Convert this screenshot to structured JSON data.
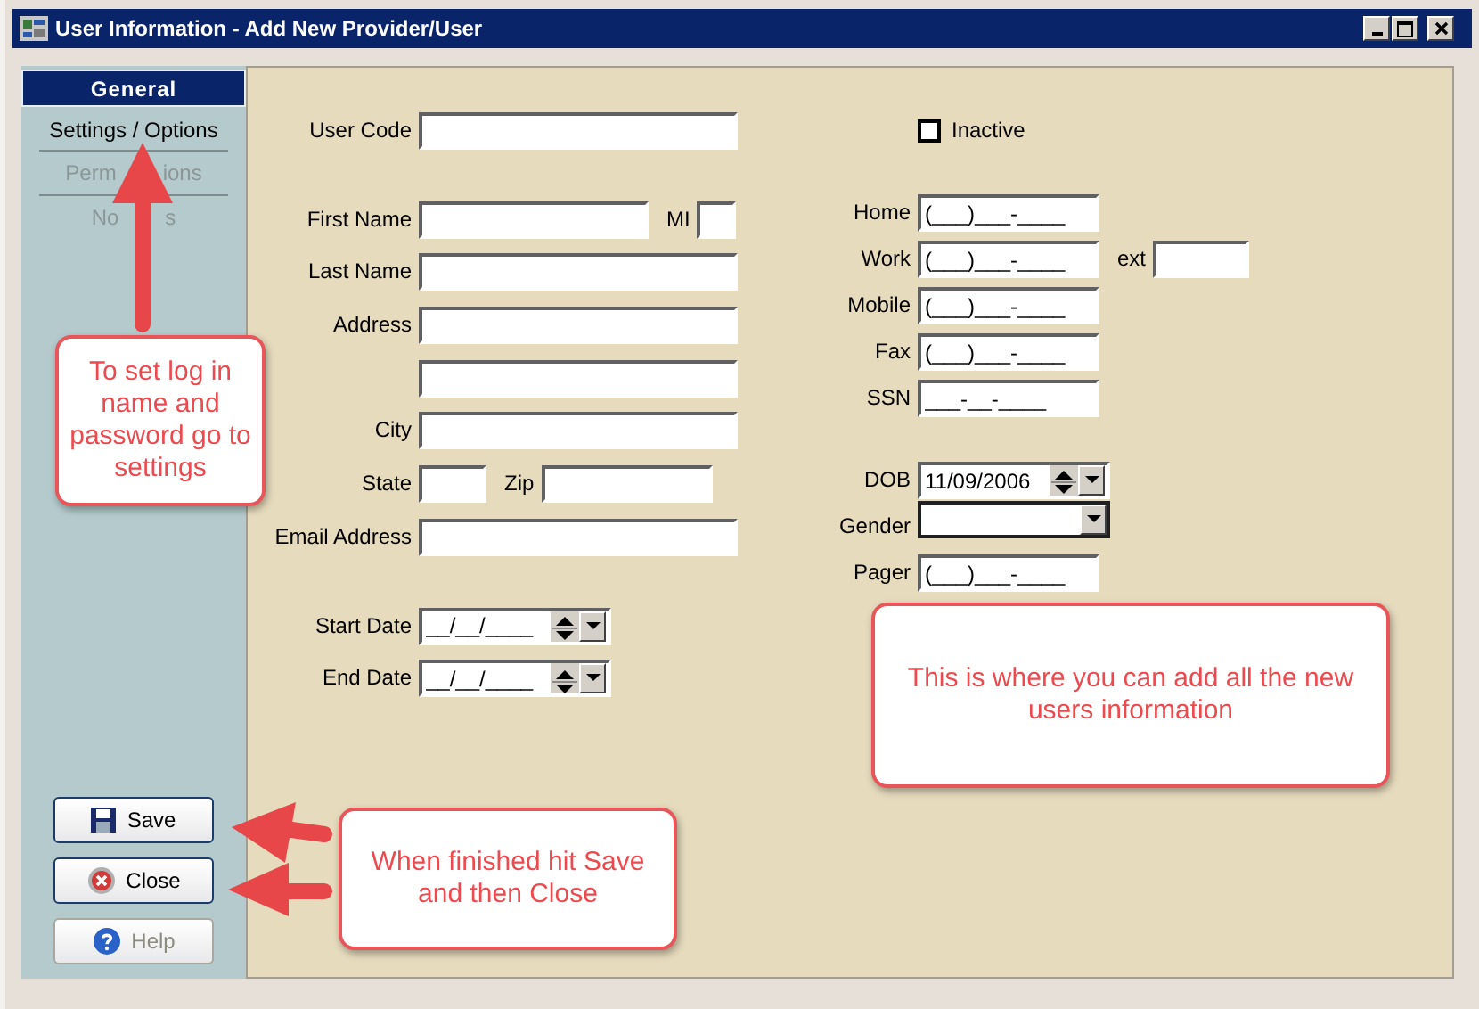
{
  "window": {
    "title": "User Information - Add New Provider/User"
  },
  "sidebar": {
    "items": [
      {
        "label": "General",
        "selected": true,
        "disabled": false
      },
      {
        "label": "Settings / Options",
        "selected": false,
        "disabled": false
      },
      {
        "label_parts": [
          "Perm",
          "ions"
        ],
        "selected": false,
        "disabled": true
      },
      {
        "label_parts": [
          "No",
          "s"
        ],
        "selected": false,
        "disabled": true
      }
    ],
    "buttons": [
      {
        "label": "Save",
        "kind": "save",
        "disabled": false
      },
      {
        "label": "Close",
        "kind": "close",
        "disabled": false
      },
      {
        "label": "Help",
        "kind": "help",
        "disabled": true
      }
    ]
  },
  "form": {
    "left_sections": [
      [
        {
          "cells": [
            {
              "kind": "label",
              "text": "User Code"
            },
            {
              "kind": "text"
            }
          ]
        }
      ],
      [
        {
          "cells": [
            {
              "kind": "label",
              "text": "First Name"
            },
            {
              "kind": "text"
            },
            {
              "kind": "inline-label",
              "text": "MI"
            },
            {
              "kind": "text"
            }
          ]
        },
        {
          "cells": [
            {
              "kind": "label",
              "text": "Last Name"
            },
            {
              "kind": "text"
            }
          ]
        },
        {
          "cells": [
            {
              "kind": "label",
              "text": "Address"
            },
            {
              "kind": "text"
            }
          ]
        },
        {
          "cells": [
            {
              "kind": "text"
            }
          ]
        },
        {
          "cells": [
            {
              "kind": "label",
              "text": "City"
            },
            {
              "kind": "text"
            }
          ]
        },
        {
          "cells": [
            {
              "kind": "label",
              "text": "State"
            },
            {
              "kind": "text"
            },
            {
              "kind": "inline-label",
              "text": "Zip"
            },
            {
              "kind": "text"
            }
          ]
        },
        {
          "cells": [
            {
              "kind": "label",
              "text": "Email Address"
            },
            {
              "kind": "text"
            }
          ]
        }
      ],
      [
        {
          "cells": [
            {
              "kind": "label",
              "text": "Start Date"
            },
            {
              "kind": "date",
              "value": "__/__/____"
            }
          ]
        },
        {
          "cells": [
            {
              "kind": "label",
              "text": "End Date"
            },
            {
              "kind": "date",
              "value": "__/__/____"
            }
          ]
        }
      ]
    ],
    "right_sections": [
      [
        {
          "cells": [
            {
              "kind": "checkbox",
              "text": "Inactive",
              "checked": false
            }
          ]
        }
      ],
      [
        {
          "cells": [
            {
              "kind": "label",
              "text": "Home"
            },
            {
              "kind": "text",
              "value": "(___)___-____"
            }
          ]
        },
        {
          "cells": [
            {
              "kind": "label",
              "text": "Work"
            },
            {
              "kind": "text",
              "value": "(___)___-____"
            },
            {
              "kind": "inline-label",
              "text": "ext"
            },
            {
              "kind": "text"
            }
          ]
        },
        {
          "cells": [
            {
              "kind": "label",
              "text": "Mobile"
            },
            {
              "kind": "text",
              "value": "(___)___-____"
            }
          ]
        },
        {
          "cells": [
            {
              "kind": "label",
              "text": "Fax"
            },
            {
              "kind": "text",
              "value": "(___)___-____"
            }
          ]
        },
        {
          "cells": [
            {
              "kind": "label",
              "text": "SSN"
            },
            {
              "kind": "text",
              "value": "___-__-____"
            }
          ]
        }
      ],
      [
        {
          "cells": [
            {
              "kind": "label",
              "text": "DOB"
            },
            {
              "kind": "date",
              "value": "11/09/2006"
            }
          ]
        },
        {
          "cells": [
            {
              "kind": "label",
              "text": "Gender"
            },
            {
              "kind": "select"
            }
          ]
        },
        {
          "cells": [
            {
              "kind": "label",
              "text": "Pager"
            },
            {
              "kind": "text",
              "value": "(___)___-____"
            }
          ]
        }
      ]
    ]
  },
  "annotations": [
    {
      "text": "To set log in name and password go to settings"
    },
    {
      "text": "This is where you can add all the new users information"
    },
    {
      "text": "When finished hit Save and then Close"
    }
  ]
}
